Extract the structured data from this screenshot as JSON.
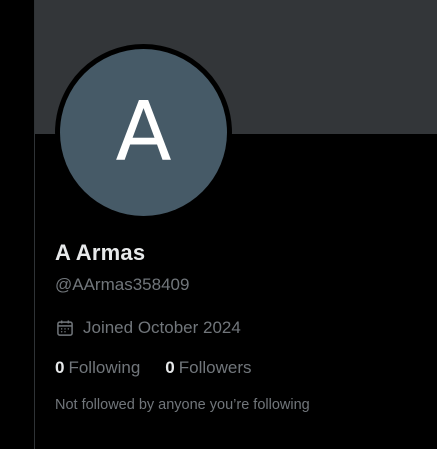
{
  "profile": {
    "avatar_letter": "A",
    "display_name": "A Armas",
    "handle": "@AArmas358409",
    "joined": "Joined October 2024",
    "joined_icon": "calendar-icon"
  },
  "stats": {
    "following_count": "0",
    "following_label": "Following",
    "followers_count": "0",
    "followers_label": "Followers"
  },
  "follow_context": "Not followed by anyone you’re following",
  "colors": {
    "background": "#000000",
    "banner": "#333639",
    "avatar": "#465a67",
    "primary_text": "#e7e9ea",
    "secondary_text": "#71767b",
    "divider": "#2f3336"
  }
}
